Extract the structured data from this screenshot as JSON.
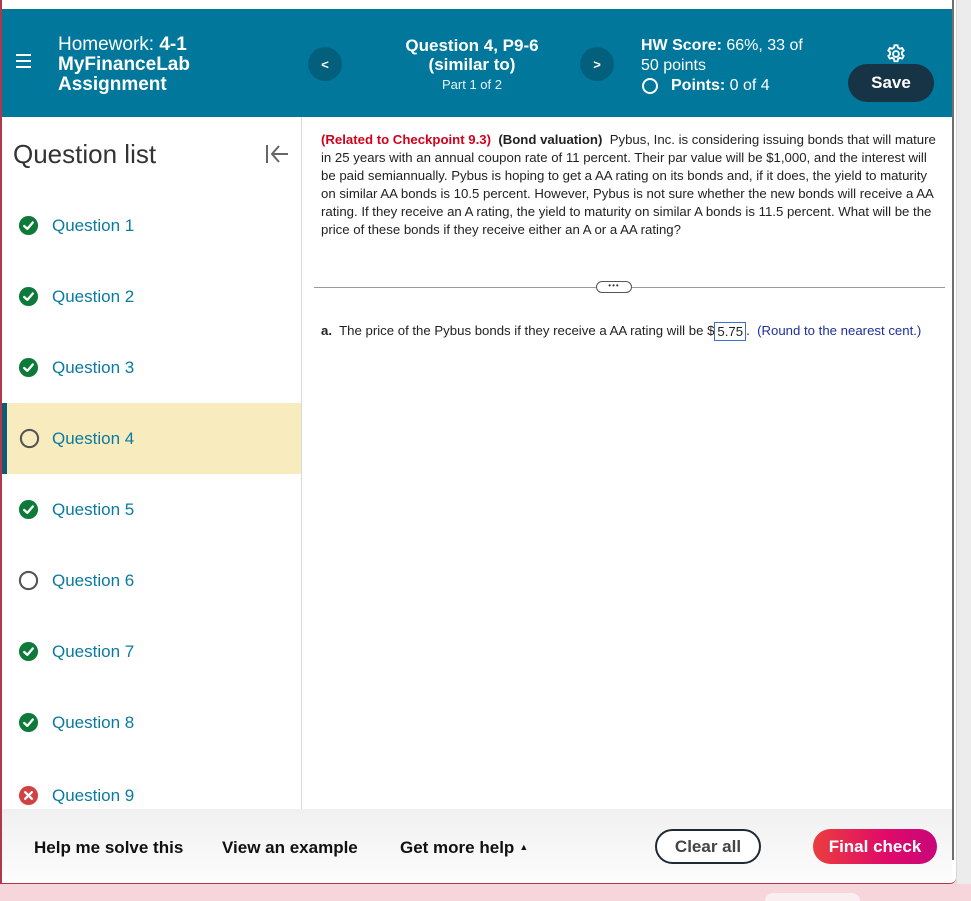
{
  "header": {
    "homework_label": "Homework:",
    "homework_id": "4-1",
    "assignment_line1": "MyFinanceLab",
    "assignment_line2": "Assignment",
    "prev_label": "<",
    "next_label": ">",
    "question_title": "Question 4, P9-6",
    "question_subtitle": "(similar to)",
    "part_label": "Part 1 of 2",
    "hw_score_label": "HW Score:",
    "hw_score_value": "66%, 33 of",
    "hw_score_value2": "50 points",
    "points_label": "Points:",
    "points_value": "0 of 4",
    "save_label": "Save"
  },
  "sidebar": {
    "title": "Question list",
    "items": [
      {
        "label": "Question 1",
        "status": "correct"
      },
      {
        "label": "Question 2",
        "status": "correct"
      },
      {
        "label": "Question 3",
        "status": "correct"
      },
      {
        "label": "Question 4",
        "status": "unanswered",
        "active": true
      },
      {
        "label": "Question 5",
        "status": "correct"
      },
      {
        "label": "Question 6",
        "status": "unanswered"
      },
      {
        "label": "Question 7",
        "status": "correct"
      },
      {
        "label": "Question 8",
        "status": "correct"
      },
      {
        "label": "Question 9",
        "status": "incorrect"
      }
    ]
  },
  "question": {
    "related": "(Related to Checkpoint 9.3)",
    "topic": "(Bond valuation)",
    "body": "Pybus, Inc. is considering issuing bonds that will mature in 25 years with an annual coupon rate of 11 percent.  Their par value will be $1,000, and the interest will be paid semiannually.  Pybus is hoping to get a AA rating on its bonds and, if it does, the yield to maturity on similar AA bonds is 10.5 percent.  However, Pybus is not sure whether the new bonds will receive a AA rating.  If they receive an A rating, the yield to maturity on similar A bonds is 11.5 percent.  What will be the price of these bonds if they receive either an A or a AA rating?",
    "expand_label": "•••",
    "part_a_label": "a.",
    "part_a_text": "The price of the Pybus bonds if they receive a AA rating will be $",
    "part_a_answer": "5.75",
    "part_a_after": ".",
    "part_a_hint": "(Round to the nearest cent.)"
  },
  "footer": {
    "help_solve": "Help me solve this",
    "view_example": "View an example",
    "get_more_help": "Get more help",
    "get_more_help_caret": "▲",
    "clear_all": "Clear all",
    "final_check": "Final check"
  },
  "colors": {
    "header_bg": "#00779b",
    "correct": "#0d7a3a",
    "incorrect": "#d14343",
    "link": "#0a7aa0",
    "active_bg": "#f8ecbf",
    "related_red": "#d0021b"
  }
}
